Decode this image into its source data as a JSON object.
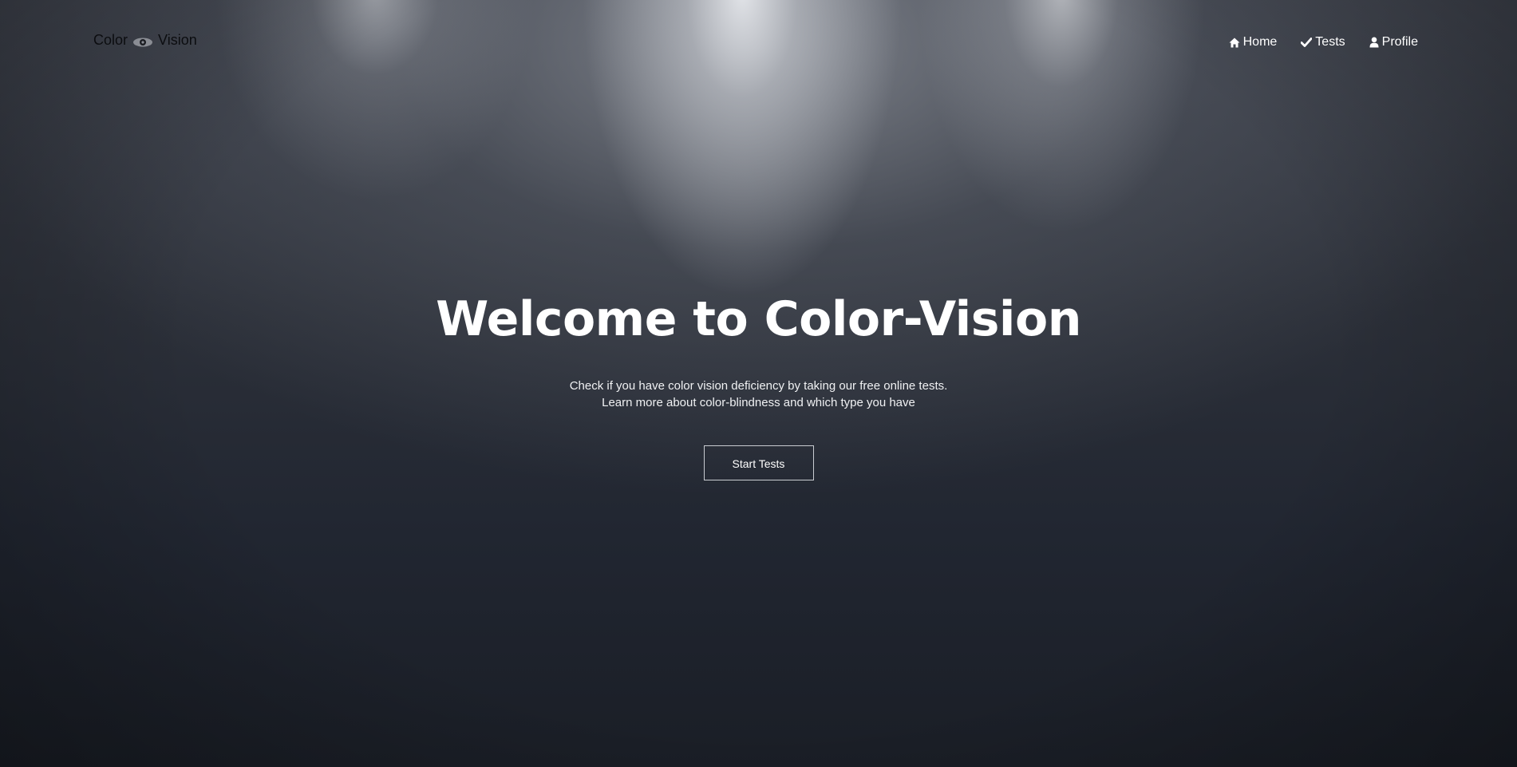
{
  "logo": {
    "text_left": "Color",
    "icon": "eye-icon",
    "text_right": "Vision"
  },
  "nav": {
    "items": [
      {
        "label": "Home",
        "icon": "home-icon"
      },
      {
        "label": "Tests",
        "icon": "check-icon"
      },
      {
        "label": "Profile",
        "icon": "user-icon"
      }
    ]
  },
  "hero": {
    "title": "Welcome to Color-Vision",
    "subtitle_line1": "Check if you have color vision deficiency by taking our free online tests.",
    "subtitle_line2": "Learn more about color-blindness and which type you have",
    "cta_label": "Start Tests"
  },
  "colors": {
    "background": "#232731",
    "text": "#ffffff",
    "logo_text": "#0c0d10",
    "button_border": "#c9ccd2"
  }
}
